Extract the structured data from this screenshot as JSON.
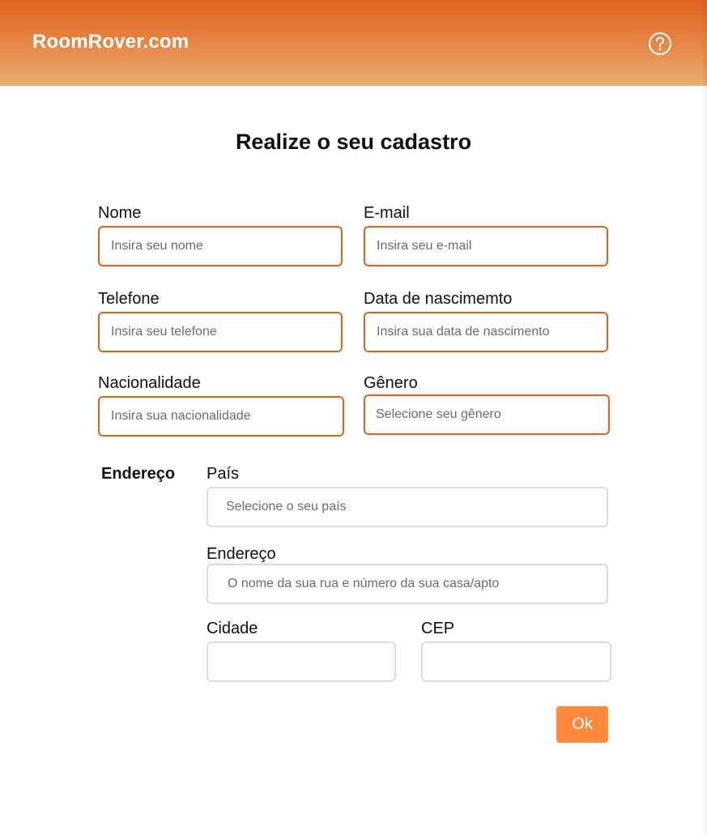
{
  "header": {
    "brand": "RoomRover.com",
    "help_icon": "question-circle-icon",
    "gradient_colors": [
      "#e0621d",
      "#e8ad72"
    ]
  },
  "form": {
    "title": "Realize o seu cadastro",
    "name": {
      "label": "Nome",
      "placeholder": "Insira seu nome",
      "value": ""
    },
    "email": {
      "label": "E-mail",
      "placeholder": "Insira seu e-mail",
      "value": ""
    },
    "phone": {
      "label": "Telefone",
      "placeholder": "Insira seu telefone",
      "value": ""
    },
    "birthdate": {
      "label": "Data de nascimemto",
      "placeholder": "Insira sua data de nascimento",
      "value": ""
    },
    "nationality": {
      "label": "Nacionalidade",
      "placeholder": "Insira sua nacionalidade",
      "value": ""
    },
    "gender": {
      "label": "Gênero",
      "selected_text": "Selecione seu gênero"
    },
    "address_section": {
      "title": "Endereço",
      "country": {
        "label": "País",
        "selected_text": "Selecione o seu país"
      },
      "street": {
        "label": "Endereço",
        "placeholder": "O nome da sua rua e número da sua casa/apto",
        "value": ""
      },
      "city": {
        "label": "Cidade",
        "placeholder": "",
        "value": ""
      },
      "zip": {
        "label": "CEP",
        "placeholder": "",
        "value": ""
      }
    },
    "submit_label": "Ok"
  },
  "colors": {
    "accent_border": "#e0621d",
    "button": "#ff8a3d",
    "neutral_border": "#dddddd"
  }
}
